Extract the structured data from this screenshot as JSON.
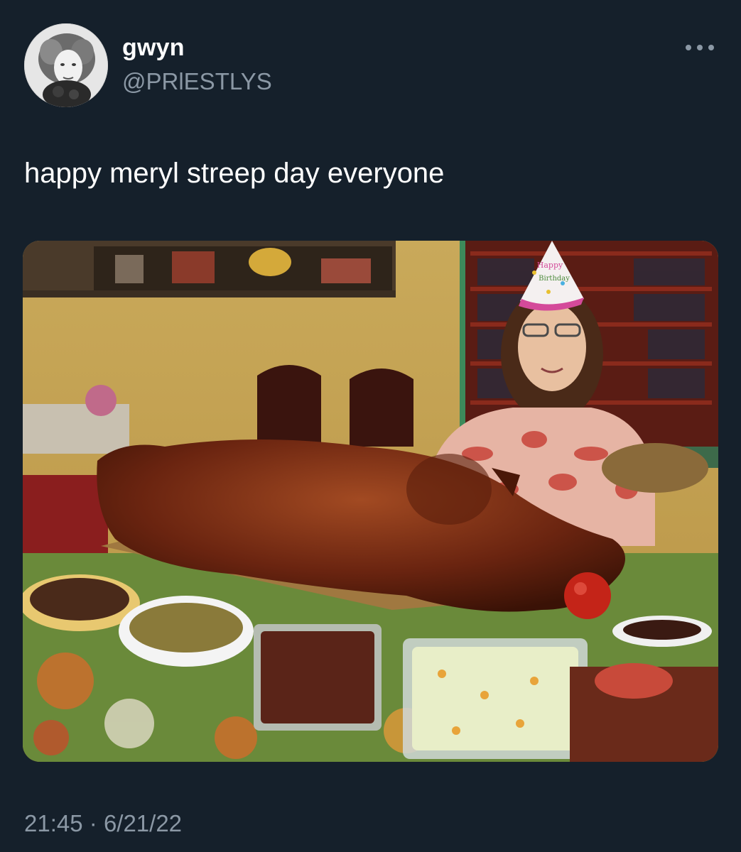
{
  "tweet": {
    "display_name": "gwyn",
    "handle": "@PRlESTLYS",
    "text": "happy meryl streep day everyone",
    "time": "21:45",
    "separator": "·",
    "date": "6/21/22",
    "more_icon": "more-horizontal-icon"
  },
  "media": {
    "hat_text_line1": "Happy",
    "hat_text_line2": "Birthday"
  },
  "colors": {
    "background": "#15202b",
    "secondary_text": "#8b98a5",
    "primary_text": "#ffffff"
  }
}
